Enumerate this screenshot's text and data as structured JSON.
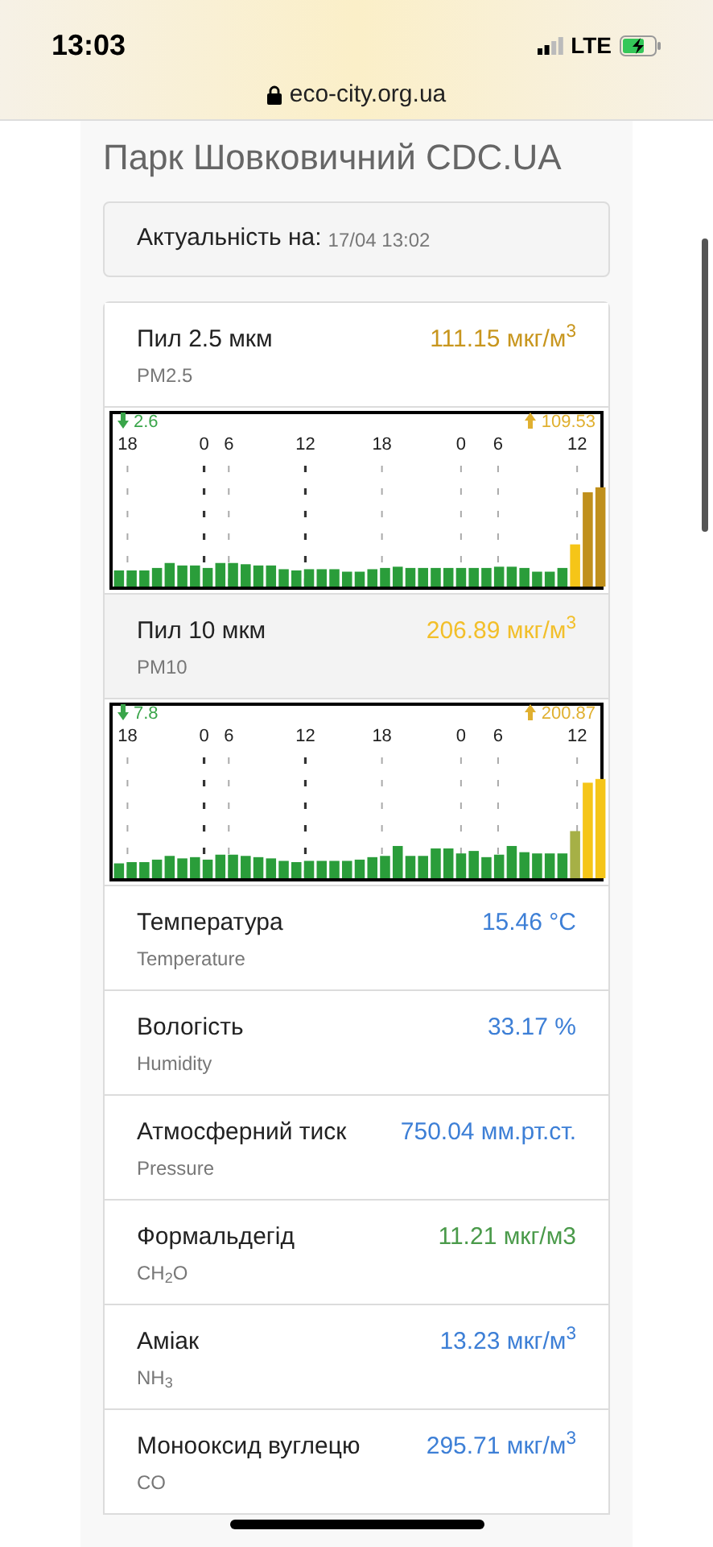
{
  "status_bar": {
    "time": "13:03",
    "network": "LTE"
  },
  "address_bar": {
    "url": "eco-city.org.ua"
  },
  "title": "Парк Шовковичний CDC.UA",
  "updated": {
    "label": "Актуальність на:",
    "value": "17/04 13:02"
  },
  "measurements": [
    {
      "kind": "chart",
      "name": "Пил 2.5 мкм",
      "code": "PM2.5",
      "value": "111.15 мкг/м$^{3}$",
      "color": "#c8961e",
      "shaded": false,
      "min": "2.6",
      "max": "109.53",
      "hours": [
        "18",
        "0",
        "6",
        "12",
        "18",
        "0",
        "6",
        "12"
      ]
    },
    {
      "kind": "chart",
      "name": "Пил 10 мкм",
      "code": "PM10",
      "value": "206.89 мкг/м$^{3}$",
      "color": "#f2bf2a",
      "shaded": true,
      "min": "7.8",
      "max": "200.87",
      "hours": [
        "18",
        "0",
        "6",
        "12",
        "18",
        "0",
        "6",
        "12"
      ]
    },
    {
      "kind": "plain",
      "name": "Температура",
      "code": "Temperature",
      "value": "15.46 °C",
      "color": "#3d7fd6"
    },
    {
      "kind": "plain",
      "name": "Вологість",
      "code": "Humidity",
      "value": "33.17 %",
      "color": "#3d7fd6"
    },
    {
      "kind": "plain",
      "name": "Атмосферний тиск",
      "code": "Pressure",
      "value": "750.04 мм.рт.ст.",
      "color": "#3d7fd6"
    },
    {
      "kind": "plain",
      "name": "Формальдегід",
      "code": "CH$_{2}$O",
      "value": "11.21 мкг/м3",
      "color": "#4a9a4a"
    },
    {
      "kind": "plain",
      "name": "Аміак",
      "code": "NH$_{3}$",
      "value": "13.23 мкг/м$^{3}$",
      "color": "#3d7fd6"
    },
    {
      "kind": "plain",
      "name": "Монооксид вуглецю",
      "code": "CO",
      "value": "295.71 мкг/м$^{3}$",
      "color": "#3d7fd6"
    }
  ]
}
